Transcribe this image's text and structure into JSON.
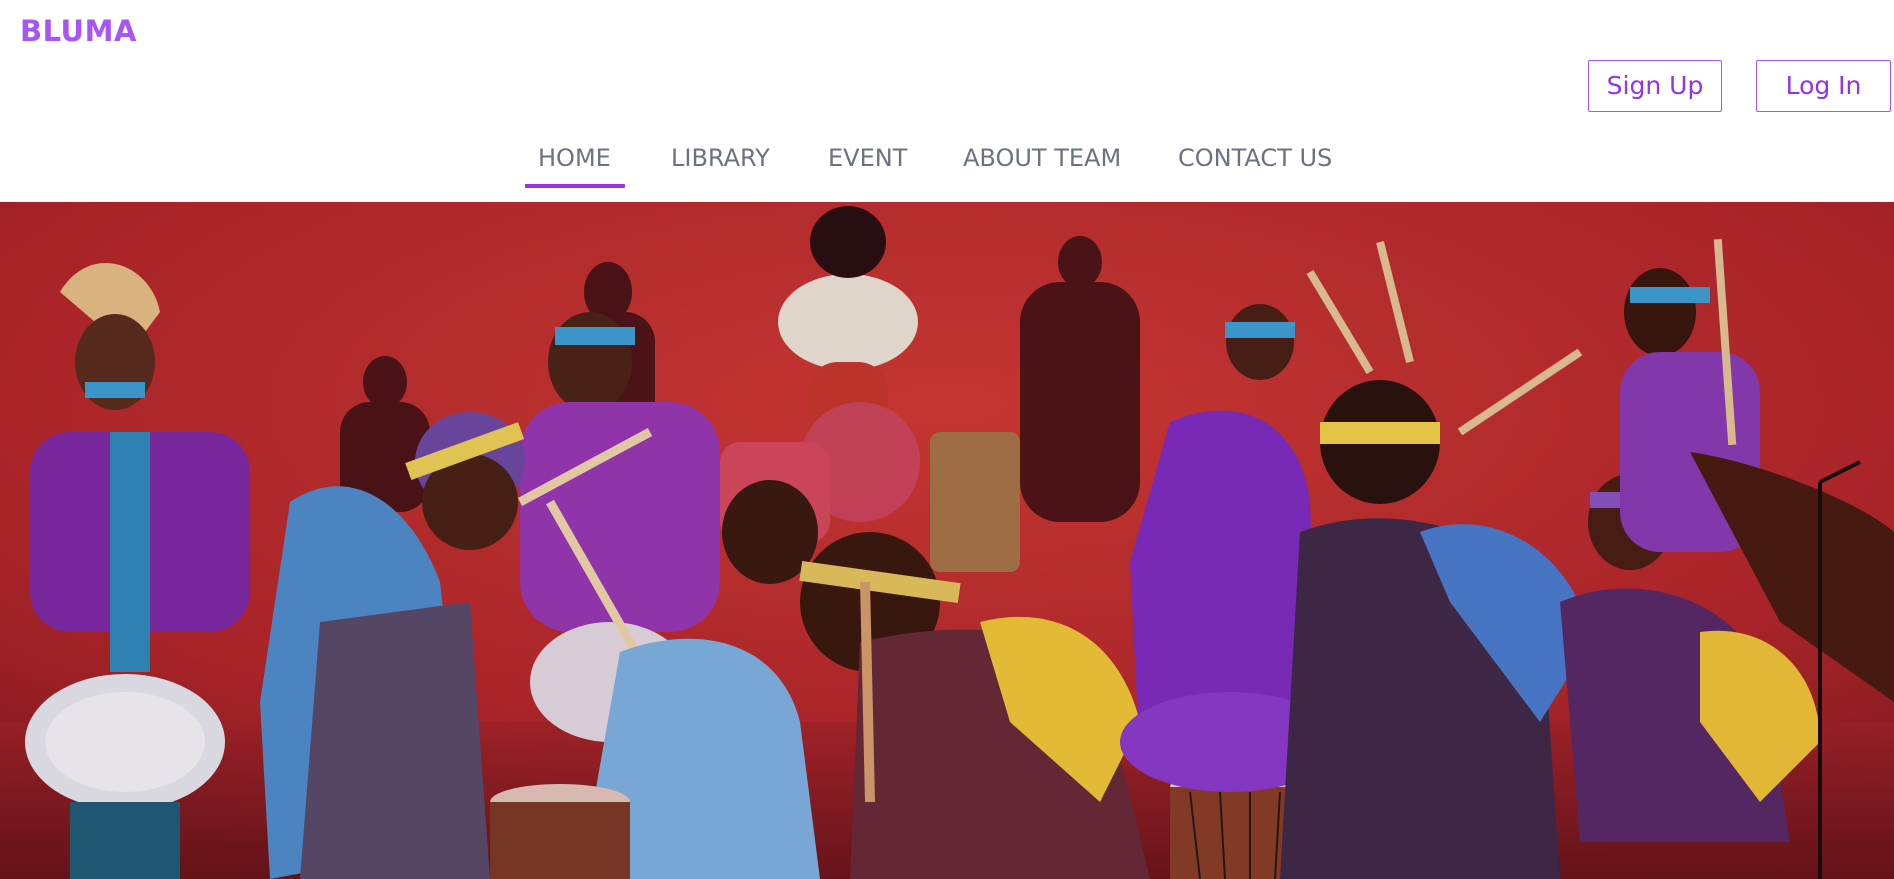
{
  "header": {
    "brand": "BLUMA",
    "signup_label": "Sign Up",
    "login_label": "Log In"
  },
  "nav": {
    "items": [
      {
        "label": "HOME",
        "active": true
      },
      {
        "label": "LIBRARY",
        "active": false
      },
      {
        "label": "EVENT",
        "active": false
      },
      {
        "label": "ABOUT TEAM",
        "active": false
      },
      {
        "label": "CONTACT US",
        "active": false
      }
    ]
  },
  "hero": {
    "image": "hero-photo-drummers-dancers-on-red-stage"
  },
  "colors": {
    "accent": "#a855f7",
    "accent_dark": "#9333ea",
    "nav_text": "#6b7280",
    "hero_bg": "#b3262d"
  }
}
